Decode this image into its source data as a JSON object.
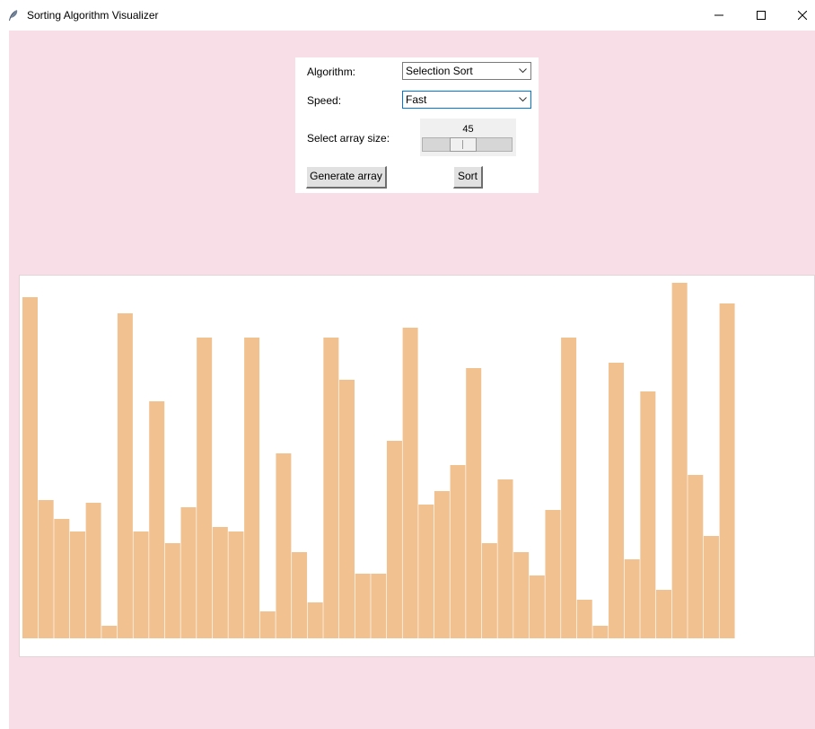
{
  "window": {
    "title": "Sorting Algorithm Visualizer",
    "icons": {
      "app": "feather-icon",
      "minimize": "minimize-icon",
      "maximize": "maximize-icon",
      "close": "close-icon"
    }
  },
  "controls": {
    "algorithm_label": "Algorithm:",
    "algorithm_value": "Selection Sort",
    "speed_label": "Speed:",
    "speed_value": "Fast",
    "array_size_label": "Select array size:",
    "array_size_value": "45",
    "array_size_min": 3,
    "array_size_max": 100,
    "generate_label": "Generate array",
    "sort_label": "Sort"
  },
  "colors": {
    "background": "#f8dee6",
    "bar": "#f2c190",
    "canvas": "#ffffff"
  },
  "chart_data": {
    "type": "bar",
    "values": [
      380,
      154,
      133,
      119,
      151,
      14,
      362,
      119,
      264,
      106,
      146,
      335,
      124,
      119,
      335,
      30,
      206,
      96,
      40,
      335,
      288,
      72,
      72,
      220,
      346,
      149,
      164,
      193,
      301,
      106,
      177,
      96,
      70,
      143,
      335,
      43,
      14,
      307,
      88,
      275,
      54,
      396,
      182,
      114,
      373
    ],
    "ylim": [
      0,
      400
    ]
  }
}
